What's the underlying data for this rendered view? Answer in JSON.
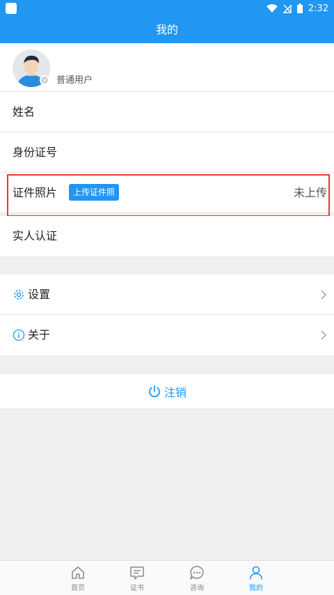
{
  "status_bar": {
    "time": "2:32"
  },
  "header": {
    "title": "我的"
  },
  "profile": {
    "username": "普通用户"
  },
  "info_rows": {
    "name_label": "姓名",
    "id_label": "身份证号",
    "photo_label": "证件照片",
    "photo_button": "上传证件照",
    "photo_status": "未上传",
    "verify_label": "实人认证"
  },
  "menu": {
    "settings_label": "设置",
    "about_label": "关于"
  },
  "logout_label": "注销",
  "tabs": [
    {
      "label": "首页",
      "icon": "home-icon"
    },
    {
      "label": "证书",
      "icon": "certificate-icon"
    },
    {
      "label": "咨询",
      "icon": "chat-icon"
    },
    {
      "label": "我的",
      "icon": "user-icon"
    }
  ],
  "colors": {
    "primary": "#2196f3",
    "highlight": "#e53935",
    "background": "#efefef"
  }
}
